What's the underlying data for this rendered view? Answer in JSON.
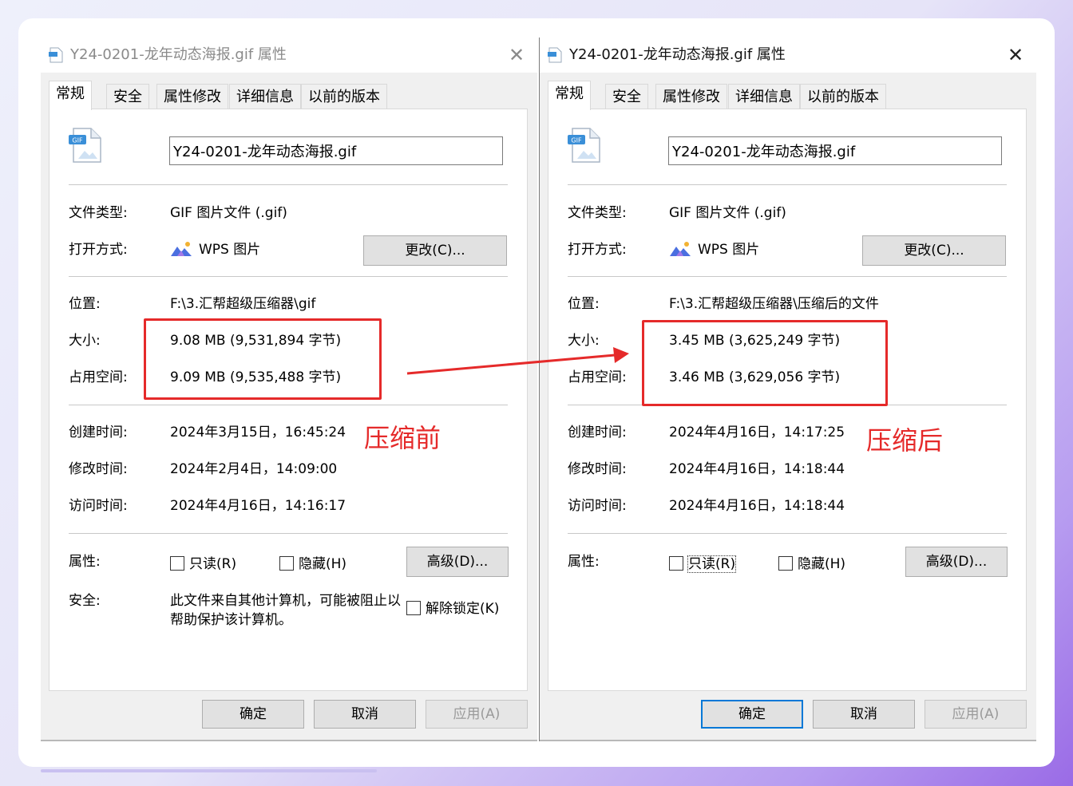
{
  "left_dialog": {
    "title": "Y24-0201-龙年动态海报.gif 属性",
    "tabs": [
      "常规",
      "安全",
      "属性修改",
      "详细信息",
      "以前的版本"
    ],
    "file_name": "Y24-0201-龙年动态海报.gif",
    "file_type_label": "文件类型:",
    "file_type": "GIF 图片文件 (.gif)",
    "open_with_label": "打开方式:",
    "open_with": "WPS 图片",
    "change_button": "更改(C)...",
    "location_label": "位置:",
    "location": "F:\\3.汇帮超级压缩器\\gif",
    "size_label": "大小:",
    "size": "9.08 MB (9,531,894 字节)",
    "disk_size_label": "占用空间:",
    "disk_size": "9.09 MB (9,535,488 字节)",
    "created_label": "创建时间:",
    "created": "2024年3月15日，16:45:24",
    "modified_label": "修改时间:",
    "modified": "2024年2月4日，14:09:00",
    "accessed_label": "访问时间:",
    "accessed": "2024年4月16日，14:16:17",
    "attributes_label": "属性:",
    "readonly": "只读(R)",
    "hidden": "隐藏(H)",
    "advanced_button": "高级(D)...",
    "security_label": "安全:",
    "security_text": "此文件来自其他计算机，可能被阻止以帮助保护该计算机。",
    "unblock": "解除锁定(K)",
    "ok_button": "确定",
    "cancel_button": "取消",
    "apply_button": "应用(A)"
  },
  "right_dialog": {
    "title": "Y24-0201-龙年动态海报.gif 属性",
    "tabs": [
      "常规",
      "安全",
      "属性修改",
      "详细信息",
      "以前的版本"
    ],
    "file_name": "Y24-0201-龙年动态海报.gif",
    "file_type_label": "文件类型:",
    "file_type": "GIF 图片文件 (.gif)",
    "open_with_label": "打开方式:",
    "open_with": "WPS 图片",
    "change_button": "更改(C)...",
    "location_label": "位置:",
    "location": "F:\\3.汇帮超级压缩器\\压缩后的文件",
    "size_label": "大小:",
    "size": "3.45 MB (3,625,249 字节)",
    "disk_size_label": "占用空间:",
    "disk_size": "3.46 MB (3,629,056 字节)",
    "created_label": "创建时间:",
    "created": "2024年4月16日，14:17:25",
    "modified_label": "修改时间:",
    "modified": "2024年4月16日，14:18:44",
    "accessed_label": "访问时间:",
    "accessed": "2024年4月16日，14:18:44",
    "attributes_label": "属性:",
    "readonly": "只读(R)",
    "hidden": "隐藏(H)",
    "advanced_button": "高级(D)...",
    "ok_button": "确定",
    "cancel_button": "取消",
    "apply_button": "应用(A)"
  },
  "annotations": {
    "before": "压缩前",
    "after": "压缩后",
    "color": "#e52a2a"
  },
  "icons": {
    "title": "gif-file-icon",
    "file": "gif-file-icon",
    "app": "wps-picture-icon",
    "close": "close-icon"
  },
  "file_icon_badge": "GIF"
}
